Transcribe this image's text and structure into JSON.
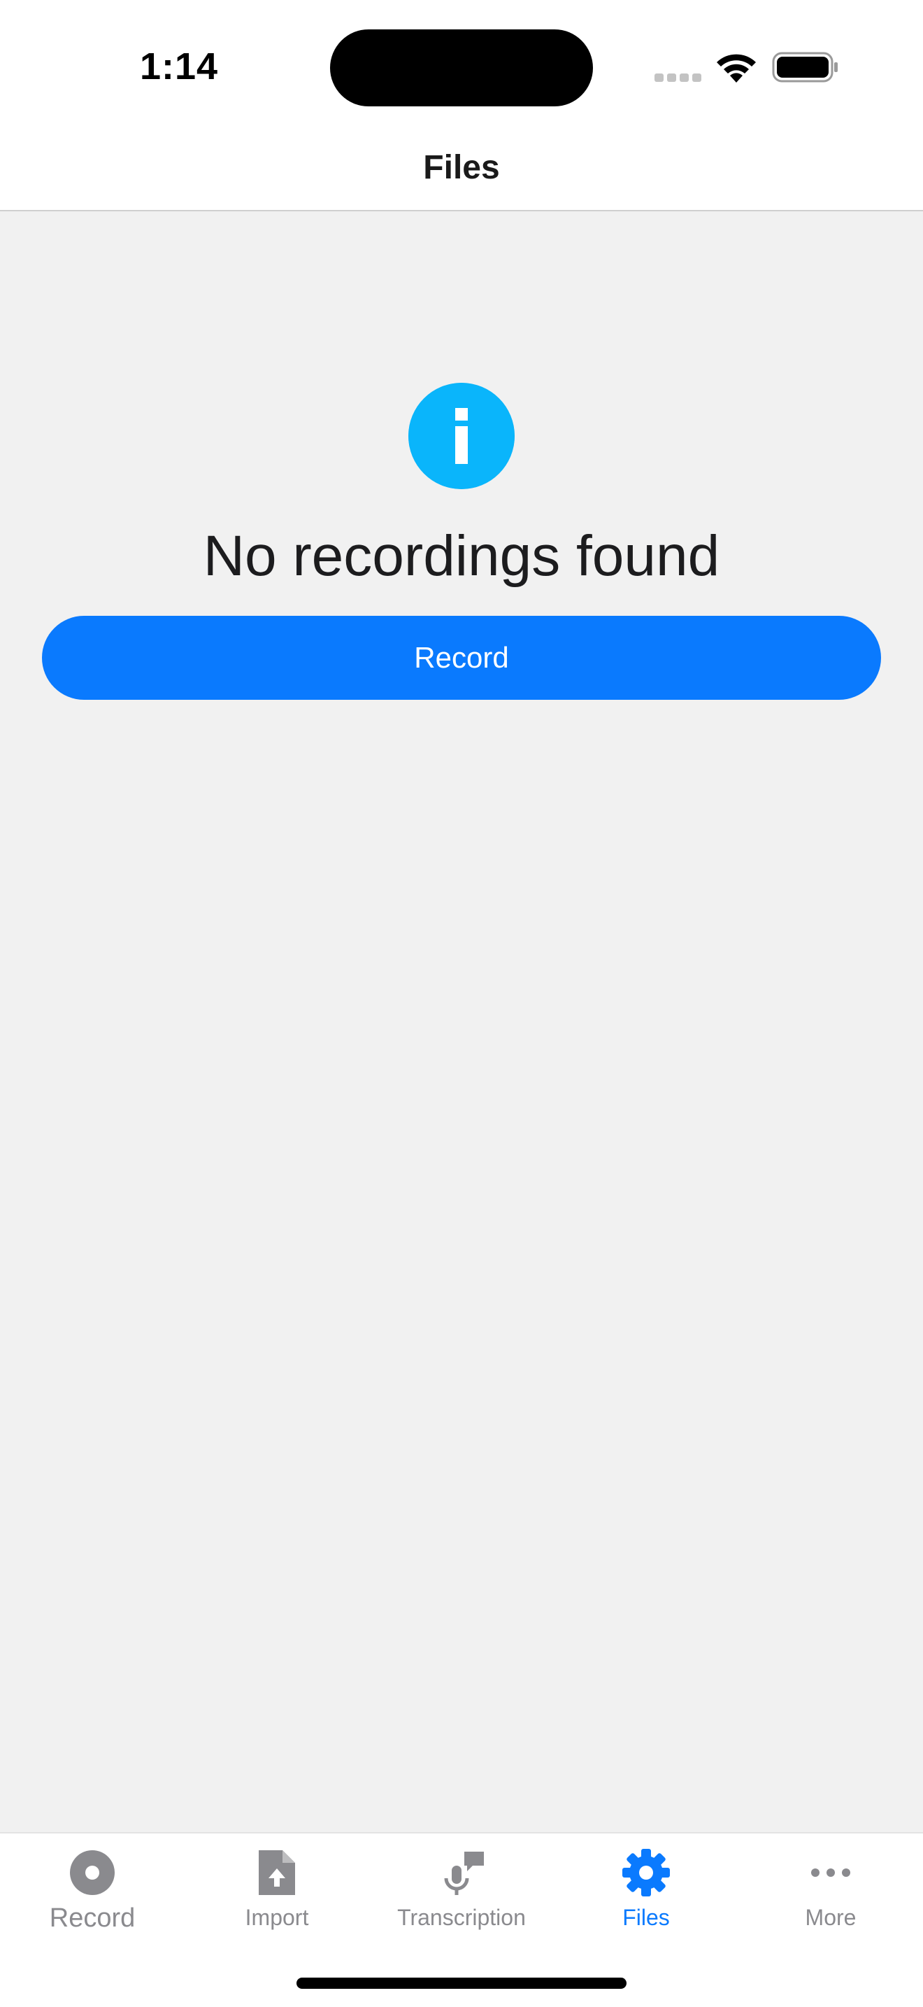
{
  "status_bar": {
    "time": "1:14"
  },
  "nav": {
    "title": "Files"
  },
  "empty_state": {
    "icon": "info-icon",
    "message": "No recordings found",
    "button_label": "Record"
  },
  "tab_bar": {
    "items": [
      {
        "label": "Record",
        "icon": "record-icon",
        "active": false
      },
      {
        "label": "Import",
        "icon": "file-upload-icon",
        "active": false
      },
      {
        "label": "Transcription",
        "icon": "microphone-speech-icon",
        "active": false
      },
      {
        "label": "Files",
        "icon": "gear-icon",
        "active": true
      },
      {
        "label": "More",
        "icon": "ellipsis-icon",
        "active": false
      }
    ]
  },
  "colors": {
    "accent": "#0a7afe",
    "info": "#0ab5fb",
    "background": "#f1f1f1",
    "inactive": "#8a8a8e"
  }
}
